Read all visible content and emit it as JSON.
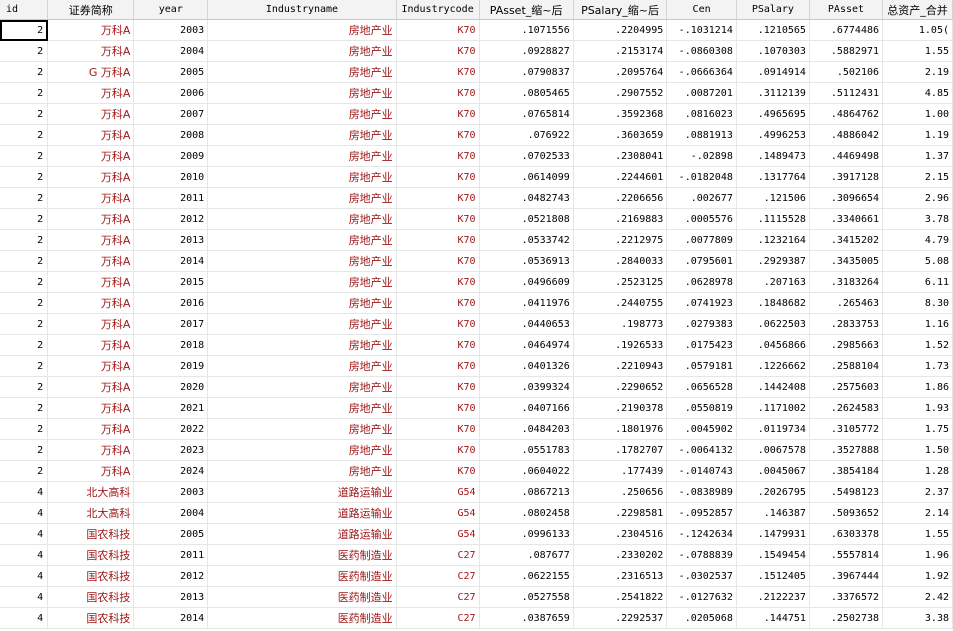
{
  "columns": [
    {
      "key": "id",
      "label": "id"
    },
    {
      "key": "name",
      "label": "证券简称"
    },
    {
      "key": "year",
      "label": "year"
    },
    {
      "key": "industryname",
      "label": "Industryname"
    },
    {
      "key": "industrycode",
      "label": "Industrycode"
    },
    {
      "key": "passet_w",
      "label": "PAsset_缩~后"
    },
    {
      "key": "psalary_w",
      "label": "PSalary_缩~后"
    },
    {
      "key": "cen",
      "label": "Cen"
    },
    {
      "key": "psalary",
      "label": "PSalary"
    },
    {
      "key": "passet",
      "label": "PAsset"
    },
    {
      "key": "total",
      "label": "总资产_合并"
    }
  ],
  "rows": [
    [
      "2",
      "万科A",
      "2003",
      "房地产业",
      "K70",
      ".1071556",
      ".2204995",
      "-.1031214",
      ".1210565",
      ".6774486",
      "1.05("
    ],
    [
      "2",
      "万科A",
      "2004",
      "房地产业",
      "K70",
      ".0928827",
      ".2153174",
      "-.0860308",
      ".1070303",
      ".5882971",
      "1.55"
    ],
    [
      "2",
      "G 万科A",
      "2005",
      "房地产业",
      "K70",
      ".0790837",
      ".2095764",
      "-.0666364",
      ".0914914",
      ".502106",
      "2.19"
    ],
    [
      "2",
      "万科A",
      "2006",
      "房地产业",
      "K70",
      ".0805465",
      ".2907552",
      ".0087201",
      ".3112139",
      ".5112431",
      "4.85"
    ],
    [
      "2",
      "万科A",
      "2007",
      "房地产业",
      "K70",
      ".0765814",
      ".3592368",
      ".0816023",
      ".4965695",
      ".4864762",
      "1.00"
    ],
    [
      "2",
      "万科A",
      "2008",
      "房地产业",
      "K70",
      ".076922",
      ".3603659",
      ".0881913",
      ".4996253",
      ".4886042",
      "1.19"
    ],
    [
      "2",
      "万科A",
      "2009",
      "房地产业",
      "K70",
      ".0702533",
      ".2308041",
      "-.02898",
      ".1489473",
      ".4469498",
      "1.37"
    ],
    [
      "2",
      "万科A",
      "2010",
      "房地产业",
      "K70",
      ".0614099",
      ".2244601",
      "-.0182048",
      ".1317764",
      ".3917128",
      "2.15"
    ],
    [
      "2",
      "万科A",
      "2011",
      "房地产业",
      "K70",
      ".0482743",
      ".2206656",
      ".002677",
      ".121506",
      ".3096654",
      "2.96"
    ],
    [
      "2",
      "万科A",
      "2012",
      "房地产业",
      "K70",
      ".0521808",
      ".2169883",
      ".0005576",
      ".1115528",
      ".3340661",
      "3.78"
    ],
    [
      "2",
      "万科A",
      "2013",
      "房地产业",
      "K70",
      ".0533742",
      ".2212975",
      ".0077809",
      ".1232164",
      ".3415202",
      "4.79"
    ],
    [
      "2",
      "万科A",
      "2014",
      "房地产业",
      "K70",
      ".0536913",
      ".2840033",
      ".0795601",
      ".2929387",
      ".3435005",
      "5.08"
    ],
    [
      "2",
      "万科A",
      "2015",
      "房地产业",
      "K70",
      ".0496609",
      ".2523125",
      ".0628978",
      ".207163",
      ".3183264",
      "6.11"
    ],
    [
      "2",
      "万科A",
      "2016",
      "房地产业",
      "K70",
      ".0411976",
      ".2440755",
      ".0741923",
      ".1848682",
      ".265463",
      "8.30"
    ],
    [
      "2",
      "万科A",
      "2017",
      "房地产业",
      "K70",
      ".0440653",
      ".198773",
      ".0279383",
      ".0622503",
      ".2833753",
      "1.16"
    ],
    [
      "2",
      "万科A",
      "2018",
      "房地产业",
      "K70",
      ".0464974",
      ".1926533",
      ".0175423",
      ".0456866",
      ".2985663",
      "1.52"
    ],
    [
      "2",
      "万科A",
      "2019",
      "房地产业",
      "K70",
      ".0401326",
      ".2210943",
      ".0579181",
      ".1226662",
      ".2588104",
      "1.73"
    ],
    [
      "2",
      "万科A",
      "2020",
      "房地产业",
      "K70",
      ".0399324",
      ".2290652",
      ".0656528",
      ".1442408",
      ".2575603",
      "1.86"
    ],
    [
      "2",
      "万科A",
      "2021",
      "房地产业",
      "K70",
      ".0407166",
      ".2190378",
      ".0550819",
      ".1171002",
      ".2624583",
      "1.93"
    ],
    [
      "2",
      "万科A",
      "2022",
      "房地产业",
      "K70",
      ".0484203",
      ".1801976",
      ".0045902",
      ".0119734",
      ".3105772",
      "1.75"
    ],
    [
      "2",
      "万科A",
      "2023",
      "房地产业",
      "K70",
      ".0551783",
      ".1782707",
      "-.0064132",
      ".0067578",
      ".3527888",
      "1.50"
    ],
    [
      "2",
      "万科A",
      "2024",
      "房地产业",
      "K70",
      ".0604022",
      ".177439",
      "-.0140743",
      ".0045067",
      ".3854184",
      "1.28"
    ],
    [
      "4",
      "北大高科",
      "2003",
      "道路运输业",
      "G54",
      ".0867213",
      ".250656",
      "-.0838989",
      ".2026795",
      ".5498123",
      "2.37"
    ],
    [
      "4",
      "北大高科",
      "2004",
      "道路运输业",
      "G54",
      ".0802458",
      ".2298581",
      "-.0952857",
      ".146387",
      ".5093652",
      "2.14"
    ],
    [
      "4",
      "国农科技",
      "2005",
      "道路运输业",
      "G54",
      ".0996133",
      ".2304516",
      "-.1242634",
      ".1479931",
      ".6303378",
      "1.55"
    ],
    [
      "4",
      "国农科技",
      "2011",
      "医药制造业",
      "C27",
      ".087677",
      ".2330202",
      "-.0788839",
      ".1549454",
      ".5557814",
      "1.96"
    ],
    [
      "4",
      "国农科技",
      "2012",
      "医药制造业",
      "C27",
      ".0622155",
      ".2316513",
      "-.0302537",
      ".1512405",
      ".3967444",
      "1.92"
    ],
    [
      "4",
      "国农科技",
      "2013",
      "医药制造业",
      "C27",
      ".0527558",
      ".2541822",
      "-.0127632",
      ".2122237",
      ".3376572",
      "2.42"
    ],
    [
      "4",
      "国农科技",
      "2014",
      "医药制造业",
      "C27",
      ".0387659",
      ".2292537",
      ".0205068",
      ".144751",
      ".2502738",
      "3.38"
    ]
  ]
}
